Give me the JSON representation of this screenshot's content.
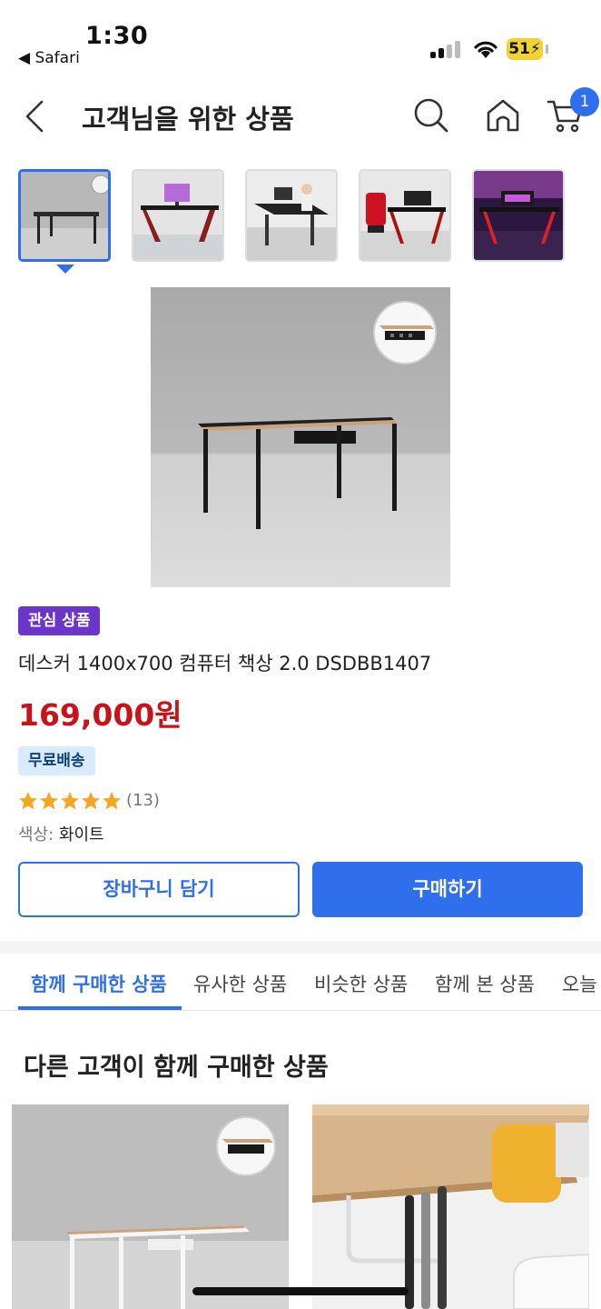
{
  "status_bar": {
    "time": "1:30",
    "back_app": "◀ Safari",
    "battery": "51"
  },
  "header": {
    "title": "고객님을 위한 상품",
    "cart_count": "1",
    "icons": [
      "back-arrow-icon",
      "search-icon",
      "home-icon",
      "cart-icon"
    ]
  },
  "thumbnails": {
    "count": 5,
    "selected_index": 0
  },
  "product": {
    "badge": "관심 상품",
    "name": "데스커 1400x700 컴퓨터 책상 2.0 DSDBB1407",
    "price": "169,000원",
    "shipping_badge": "무료배송",
    "rating": 5,
    "review_count": "(13)",
    "color_label": "색상:",
    "color_value": "화이트"
  },
  "actions": {
    "add_to_cart": "장바구니 담기",
    "buy_now": "구매하기"
  },
  "tabs": [
    {
      "label": "함께 구매한 상품",
      "active": true
    },
    {
      "label": "유사한 상품",
      "active": false
    },
    {
      "label": "비슷한 상품",
      "active": false
    },
    {
      "label": "함께 본 상품",
      "active": false
    },
    {
      "label": "오늘",
      "active": false
    }
  ],
  "section": {
    "title": "다른 고객이 함께 구매한 상품"
  },
  "colors": {
    "accent": "#2f6fed",
    "price": "#c8131b",
    "interest_badge": "#6c35c9",
    "shipping_badge_bg": "#d9ecff",
    "star": "#f5a623"
  }
}
